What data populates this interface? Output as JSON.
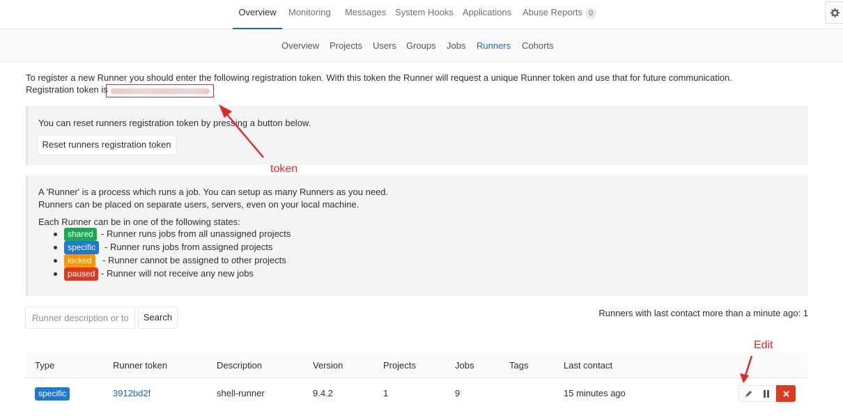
{
  "top_nav": {
    "tabs": [
      {
        "label": "Overview",
        "active": true
      },
      {
        "label": "Monitoring"
      },
      {
        "label": "Messages"
      },
      {
        "label": "System Hooks"
      },
      {
        "label": "Applications"
      },
      {
        "label": "Abuse Reports",
        "count": "0"
      }
    ],
    "settings_icon": "gear-icon"
  },
  "sub_nav": {
    "tabs": [
      {
        "label": "Overview"
      },
      {
        "label": "Projects"
      },
      {
        "label": "Users"
      },
      {
        "label": "Groups"
      },
      {
        "label": "Jobs"
      },
      {
        "label": "Runners",
        "active": true
      },
      {
        "label": "Cohorts"
      }
    ]
  },
  "registration": {
    "intro": "To register a new Runner you should enter the following registration token. With this token the Runner will request a unique Runner token and use that for future communication.",
    "token_label": "Registration token is"
  },
  "reset_box": {
    "text": "You can reset runners registration token by pressing a button below.",
    "button": "Reset runners registration token"
  },
  "about_box": {
    "line1": "A 'Runner' is a process which runs a job. You can setup as many Runners as you need.",
    "line2": "Runners can be placed on separate users, servers, even on your local machine.",
    "states_intro": "Each Runner can be in one of the following states:",
    "states": [
      {
        "label": "shared",
        "desc": "- Runner runs jobs from all unassigned projects",
        "color": "#1aaa55"
      },
      {
        "label": "specific",
        "desc": "- Runner runs jobs from assigned projects",
        "color": "#1f78d1"
      },
      {
        "label": "locked",
        "desc": "- Runner cannot be assigned to other projects",
        "color": "#fc9403"
      },
      {
        "label": "paused",
        "desc": "- Runner will not receive any new jobs",
        "color": "#db3b21"
      }
    ]
  },
  "search": {
    "placeholder": "Runner description or token",
    "button": "Search"
  },
  "contact_summary": "Runners with last contact more than a minute ago: 1",
  "table": {
    "headers": [
      "Type",
      "Runner token",
      "Description",
      "Version",
      "Projects",
      "Jobs",
      "Tags",
      "Last contact"
    ],
    "rows": [
      {
        "type": "specific",
        "token": "3912bd2f",
        "description": "shell-runner",
        "version": "9.4.2",
        "projects": "1",
        "jobs": "9",
        "tags": "",
        "last_contact": "15 minutes ago"
      }
    ]
  },
  "annotations": {
    "token": "token",
    "edit": "Edit",
    "color": "#e02828"
  },
  "colors": {
    "accent": "#1b69b6",
    "danger": "#db3b21"
  }
}
